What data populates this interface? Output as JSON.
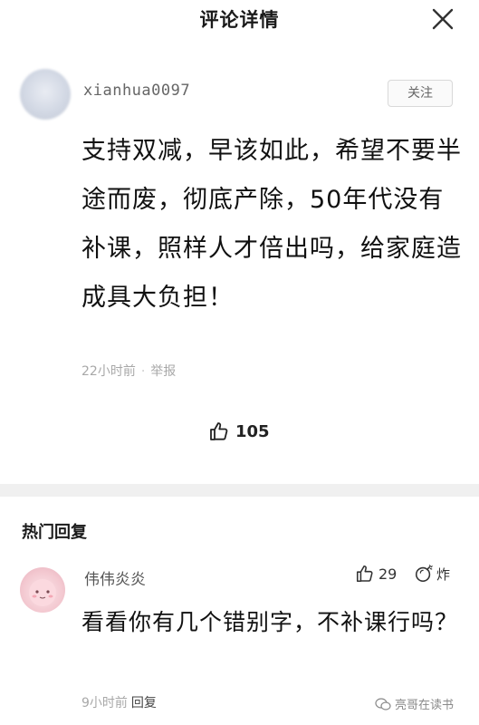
{
  "header": {
    "title": "评论详情",
    "close_icon": "close-icon"
  },
  "main_comment": {
    "username": "xianhua0097",
    "follow_label": "关注",
    "text": "支持双减，早该如此，希望不要半途而废，彻底产除，50年代没有补课，照样人才倍出吗，给家庭造成具大负担！",
    "time": "22小时前",
    "report_label": "举报",
    "like_count": "105",
    "like_icon": "thumbs-up-icon"
  },
  "hot_replies": {
    "title": "热门回复",
    "items": [
      {
        "username": "伟伟炎炎",
        "like_count": "29",
        "react_label": "炸",
        "text": "看看你有几个错别字，不补课行吗？",
        "time": "9小时前",
        "reply_label": "回复"
      }
    ]
  },
  "watermark": {
    "text": "亮哥在读书"
  },
  "colors": {
    "background": "#ffffff",
    "divider": "#f0f0f0",
    "meta_text": "#a8a8a8"
  }
}
